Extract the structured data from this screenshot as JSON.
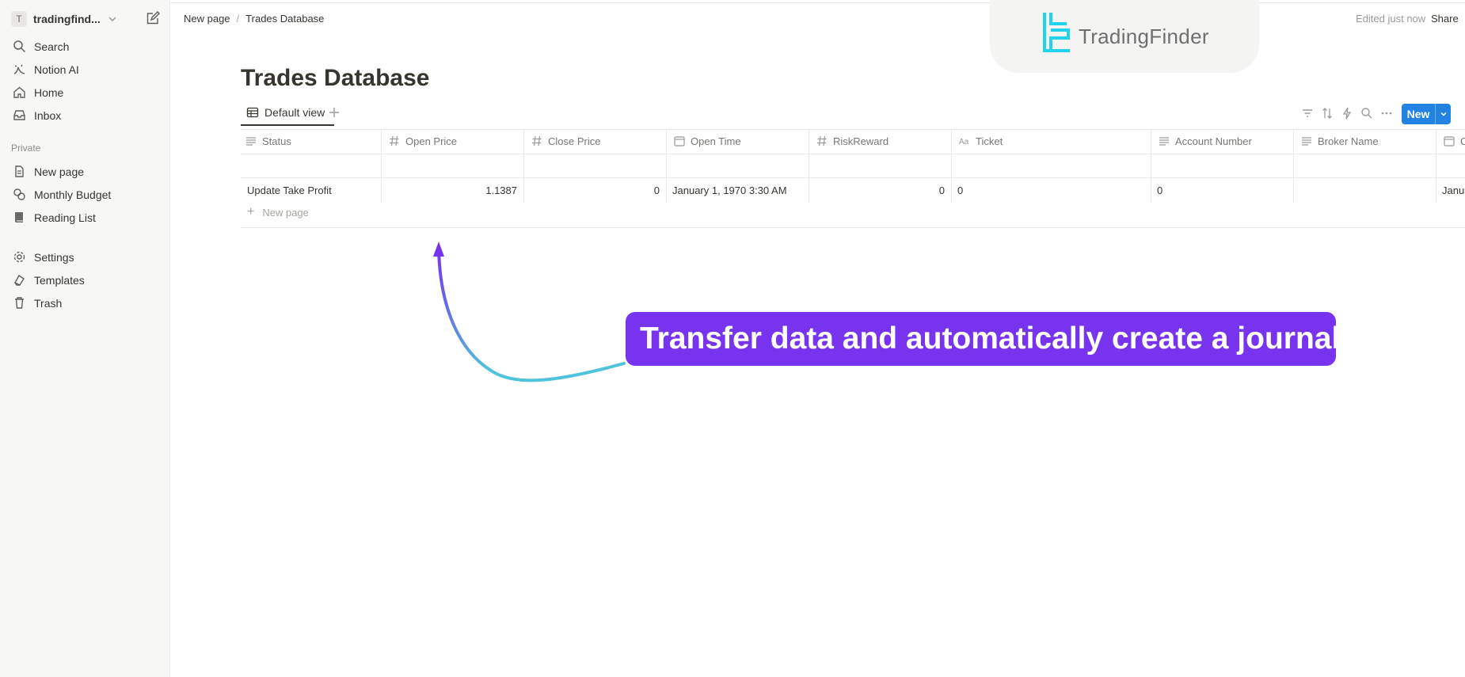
{
  "sidebar": {
    "workspace": {
      "badge": "T",
      "name": "tradingfind..."
    },
    "nav_top": [
      {
        "label": "Search",
        "icon": "search-icon"
      },
      {
        "label": "Notion AI",
        "icon": "notion-ai-icon"
      },
      {
        "label": "Home",
        "icon": "home-icon"
      },
      {
        "label": "Inbox",
        "icon": "inbox-icon"
      }
    ],
    "section_label": "Private",
    "pages": [
      {
        "label": "New page",
        "icon": "page-icon"
      },
      {
        "label": "Monthly Budget",
        "icon": "budget-icon"
      },
      {
        "label": "Reading List",
        "icon": "book-icon"
      }
    ],
    "nav_bottom": [
      {
        "label": "Settings",
        "icon": "gear-icon"
      },
      {
        "label": "Templates",
        "icon": "templates-icon"
      },
      {
        "label": "Trash",
        "icon": "trash-icon"
      }
    ]
  },
  "topbar": {
    "breadcrumb": [
      "New page",
      "Trades Database"
    ],
    "breadcrumb_separator": "/",
    "edited": "Edited just now",
    "share": "Share"
  },
  "logo": {
    "text": "TradingFinder",
    "color": "#22d3ee"
  },
  "page": {
    "title": "Trades Database",
    "view_tab": "Default view",
    "new_button": "New",
    "accent_color": "#2383e2"
  },
  "table": {
    "columns": [
      {
        "label": "Status",
        "icon": "text-icon"
      },
      {
        "label": "Open Price",
        "icon": "number-icon"
      },
      {
        "label": "Close Price",
        "icon": "number-icon"
      },
      {
        "label": "Open Time",
        "icon": "date-icon"
      },
      {
        "label": "RiskReward",
        "icon": "number-icon"
      },
      {
        "label": "Ticket",
        "icon": "title-icon"
      },
      {
        "label": "Account Number",
        "icon": "text-icon"
      },
      {
        "label": "Broker Name",
        "icon": "text-icon"
      },
      {
        "label": "C",
        "icon": "date-icon"
      }
    ],
    "rows": [
      [
        "",
        "",
        "",
        "",
        "",
        "",
        "",
        "",
        ""
      ],
      [
        "Update Take Profit",
        "1.1387",
        "0",
        "January 1, 1970 3:30 AM",
        "0",
        "0",
        "0",
        "",
        "Janua"
      ]
    ],
    "new_row_label": "New page"
  },
  "annotation": {
    "text": "Transfer data and automatically create a journal",
    "color": "#7733ee"
  }
}
